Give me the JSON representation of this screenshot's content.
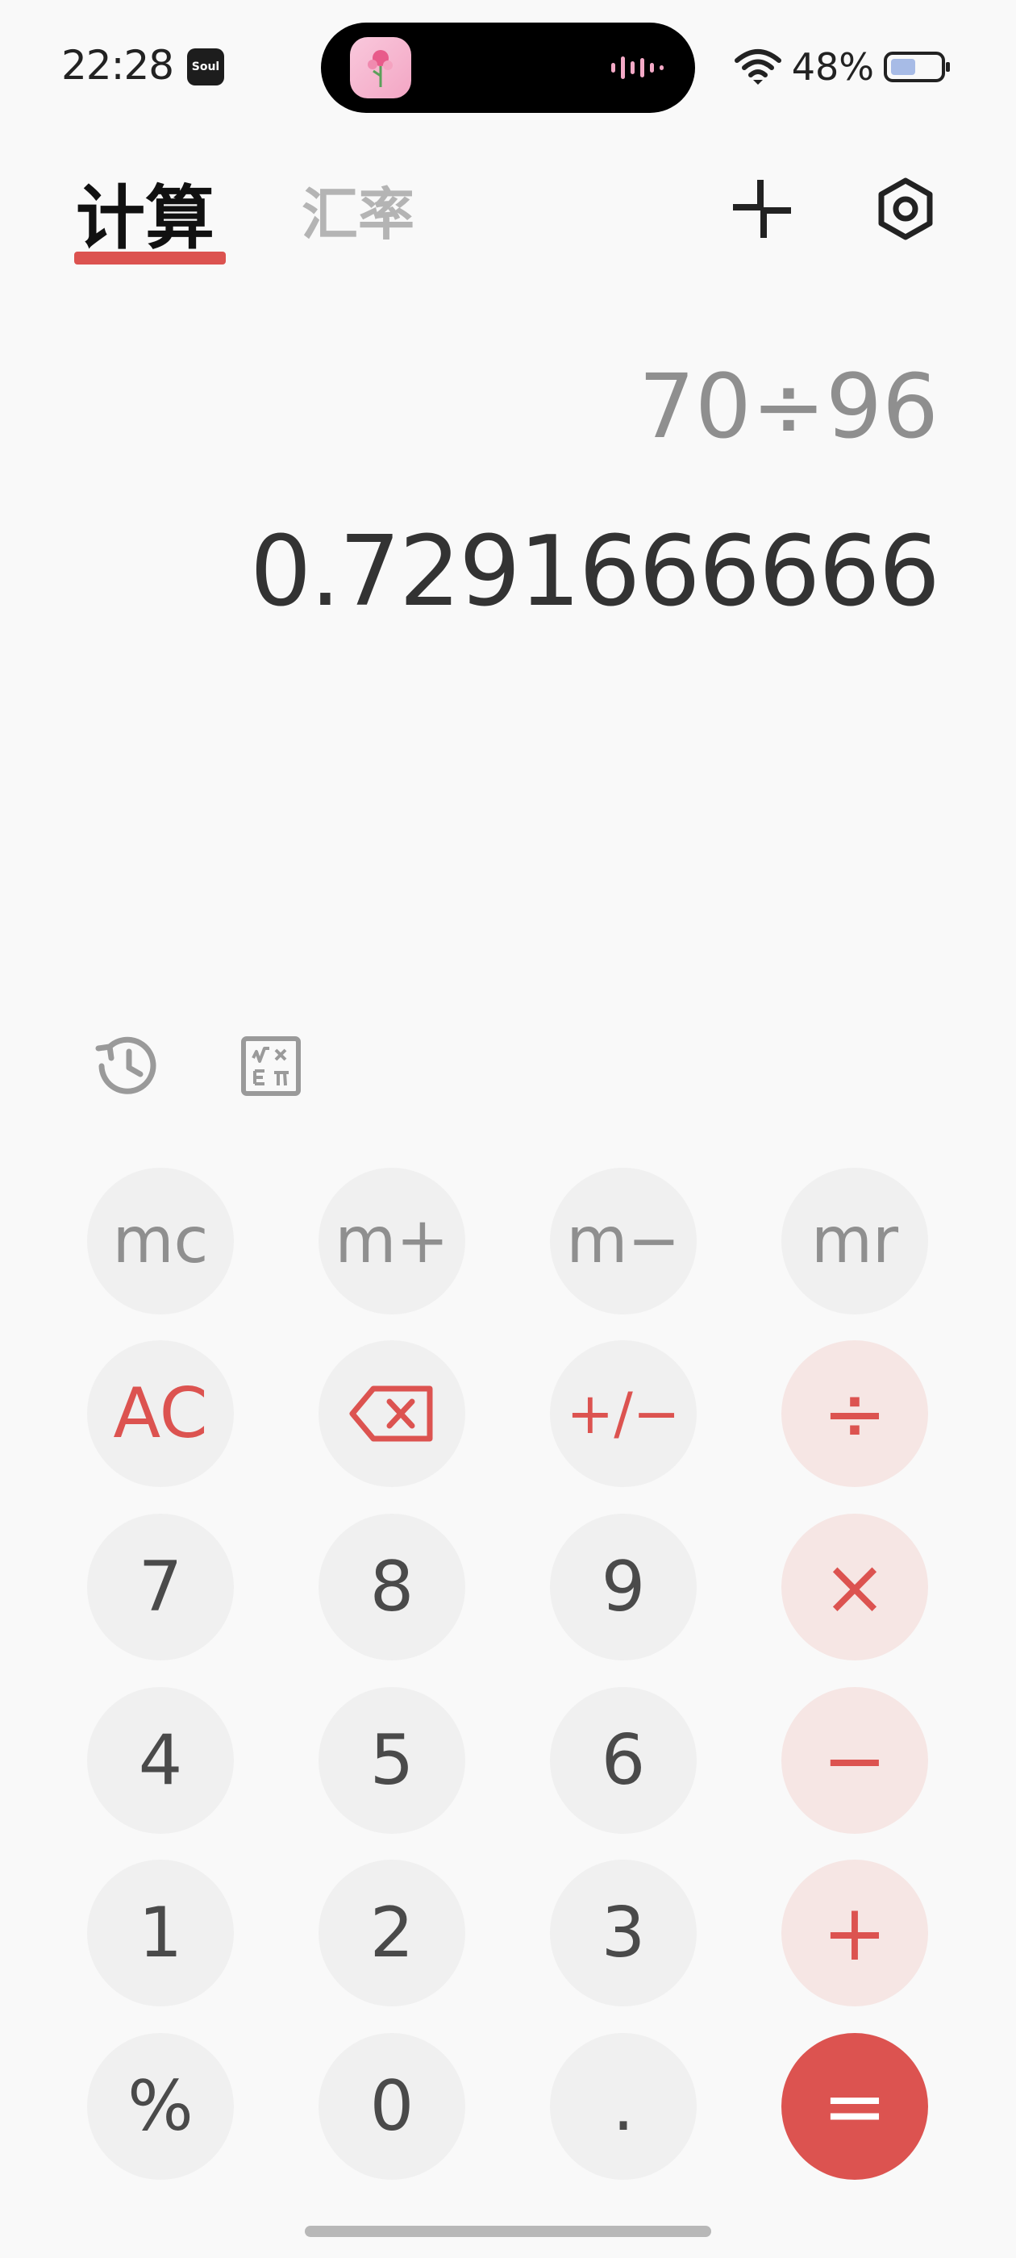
{
  "status_bar": {
    "time": "22:28",
    "notification_app_label": "Soul",
    "battery": "48%"
  },
  "header": {
    "tab_calculator": "计算",
    "tab_exchange_rate": "汇率"
  },
  "display": {
    "expression": "70÷96",
    "result": "0.7291666666"
  },
  "keypad": {
    "mc": "mc",
    "m_plus": "m+",
    "m_minus": "m−",
    "mr": "mr",
    "ac": "AC",
    "plus_minus": "+/−",
    "divide": "÷",
    "seven": "7",
    "eight": "8",
    "nine": "9",
    "multiply": "×",
    "four": "4",
    "five": "5",
    "six": "6",
    "minus": "−",
    "one": "1",
    "two": "2",
    "three": "3",
    "plus": "+",
    "percent": "%",
    "zero": "0",
    "decimal": ".",
    "equals": "="
  },
  "colors": {
    "accent": "#dc5350",
    "operator_bg": "#f6e6e4",
    "key_bg": "#f0f0f0",
    "background": "#f9f9f9"
  },
  "icons": {
    "history": "history-icon",
    "scientific": "scientific-functions-icon",
    "collapse": "collapse-icon",
    "settings": "settings-icon",
    "backspace": "backspace-icon"
  }
}
